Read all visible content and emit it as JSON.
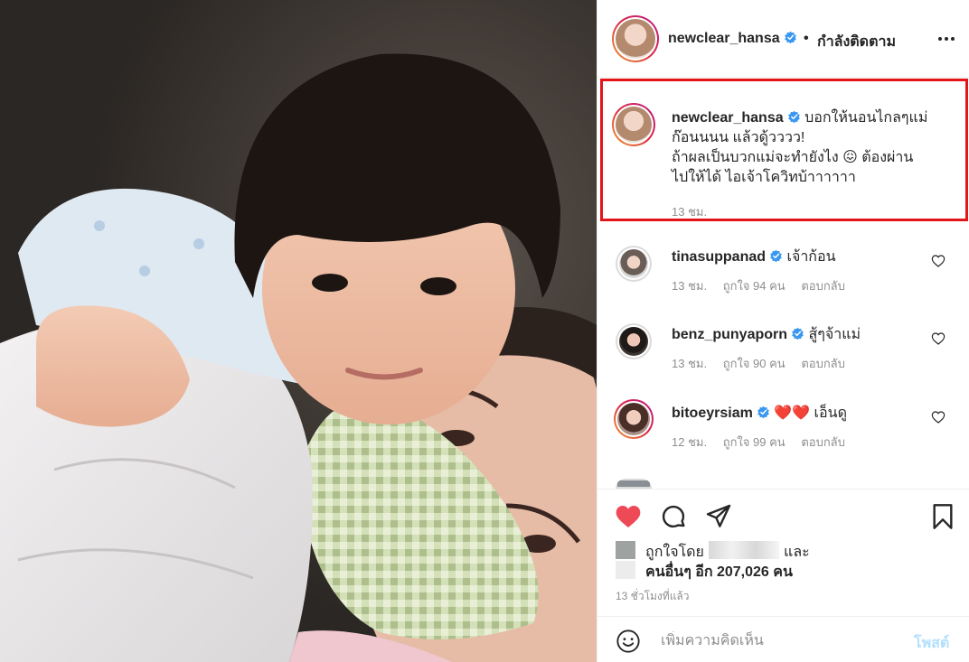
{
  "post": {
    "author": "newclear_hansa",
    "separator": "•",
    "follow_status": "กำลังติดตาม",
    "caption_lines": [
      "บอกให้นอนไกลๆแม่",
      "ก๊อนนนน แล้วดู้วววว!",
      "ถ้าผลเป็นบวกแม่จะทำยังไง 😖 ต้องผ่าน",
      "ไปให้ได้ ไอเจ้าโควิทบ้าาาาาา"
    ],
    "caption_time": "13 ชม.",
    "photo_alt": "selfie"
  },
  "comments": [
    {
      "user": "tinasuppanad",
      "text": "เจ้าก้อน",
      "time": "13 ชม.",
      "likes": "ถูกใจ 94 คน",
      "reply": "ตอบกลับ"
    },
    {
      "user": "benz_punyaporn",
      "text": "สู้ๆจ้าแม่",
      "time": "13 ชม.",
      "likes": "ถูกใจ 90 คน",
      "reply": "ตอบกลับ"
    },
    {
      "user": "bitoeyrsiam",
      "text": "❤️❤️ เอ็นดู",
      "time": "12 ชม.",
      "likes": "ถูกใจ 99 คน",
      "reply": "ตอบกลับ"
    }
  ],
  "likes": {
    "liked_by_prefix": "ถูกใจโดย",
    "and": "และ",
    "others": "คนอื่นๆ อีก 207,026 คน"
  },
  "time_ago": "13 ชั่วโมงที่แล้ว",
  "add_comment": {
    "placeholder": "เพิ่มความคิดเห็น",
    "post_label": "โพสต์"
  },
  "icons": {
    "like": "heart-icon",
    "comment": "comment-icon",
    "share": "share-icon",
    "save": "bookmark-icon",
    "emoji": "emoji-icon",
    "more": "more-icon"
  },
  "colors": {
    "like_red": "#ed4956",
    "verified_blue": "#3897f0",
    "highlight_red": "#e3151b",
    "post_button_disabled": "#b2dffc"
  }
}
